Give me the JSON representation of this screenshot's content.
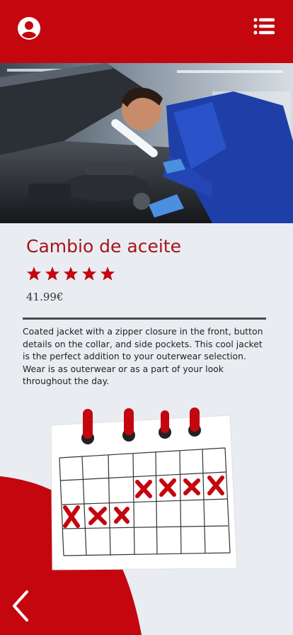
{
  "header": {
    "brand_color": "#c4060f",
    "profile_icon": "user-circle-icon",
    "menu_icon": "list-menu-icon"
  },
  "hero": {
    "image": "mechanic-inspecting-car-engine-photo"
  },
  "service": {
    "title": "Cambio de aceite",
    "rating": 5,
    "rating_max": 5,
    "price": "41.99€",
    "description": "Coated jacket with a zipper closure in the front, button details on the collar, and side pockets. This cool jacket is the perfect addition to your outerwear selection. Wear is as outerwear or as a part of your look throughout the day."
  },
  "illustration": {
    "image": "calendar-with-crossed-days-icon",
    "crossed_days": 7
  },
  "footer": {
    "back_icon": "chevron-left-icon"
  }
}
